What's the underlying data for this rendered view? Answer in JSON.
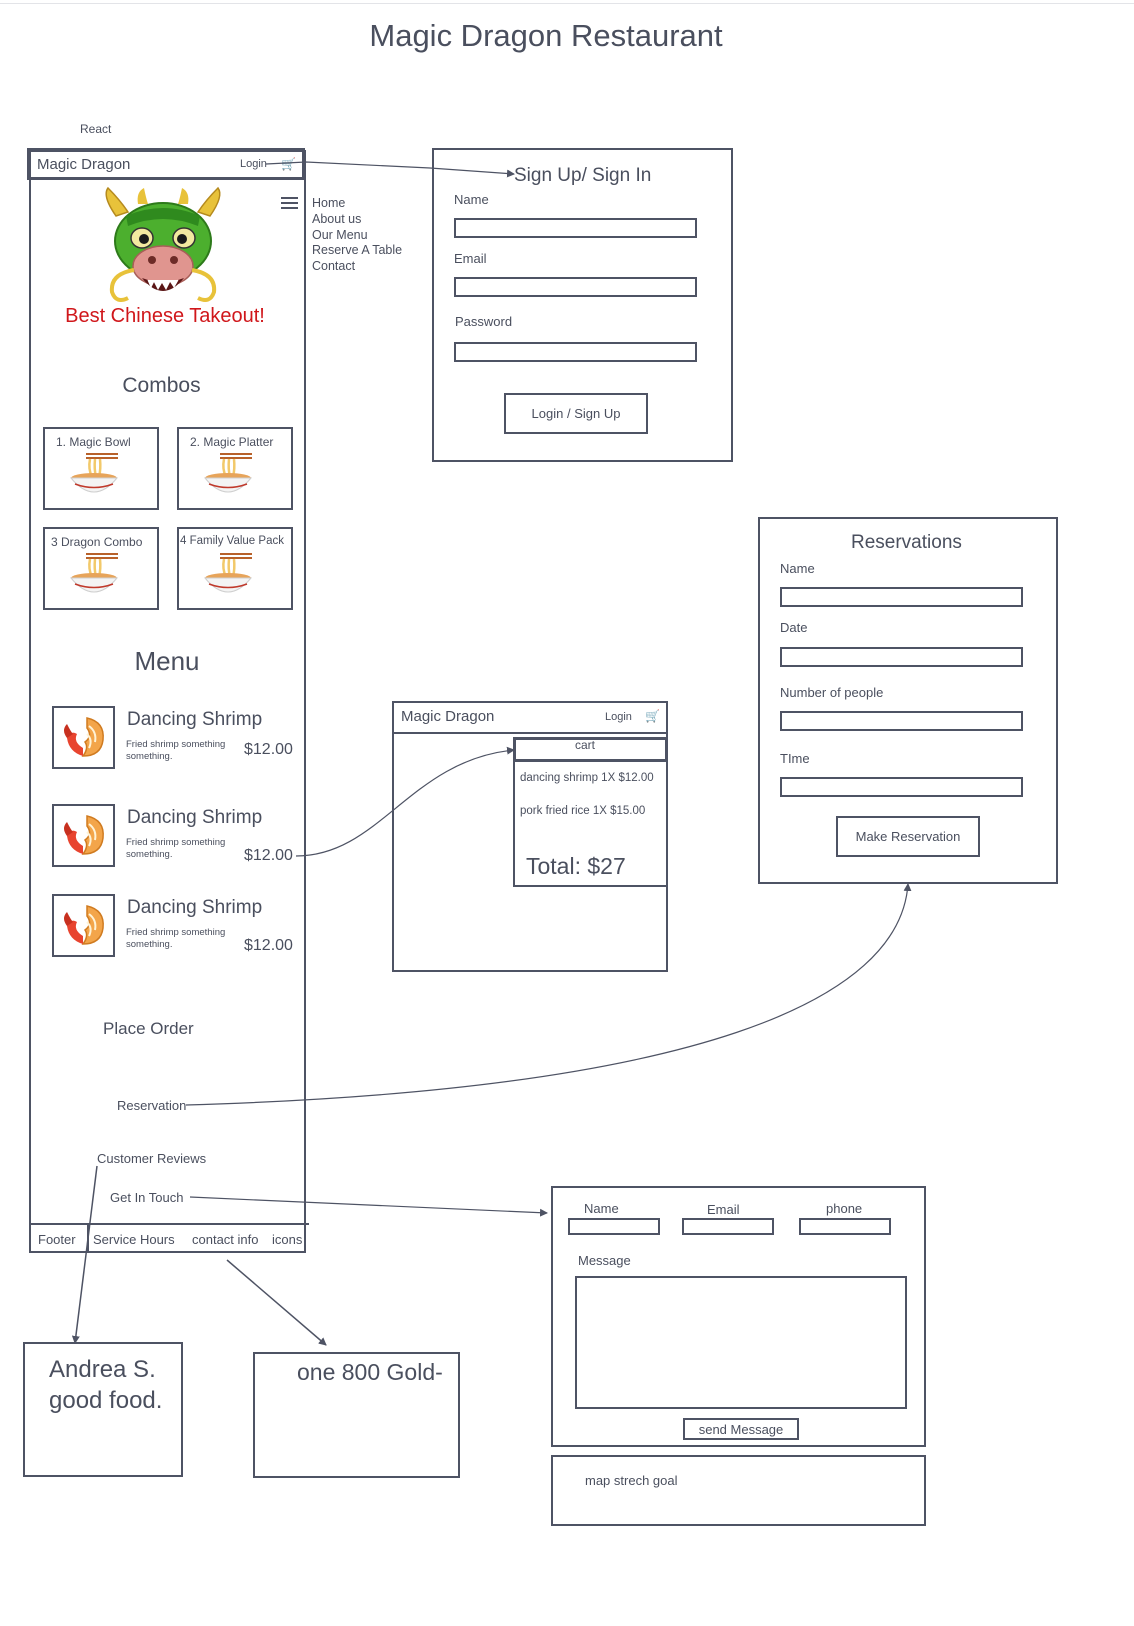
{
  "page_title": "Magic Dragon Restaurant",
  "react_label": "React",
  "phone": {
    "brand": "Magic Dragon",
    "login": "Login",
    "nav_items": [
      "Home",
      "About us",
      "Our Menu",
      "Reserve A Table",
      "Contact"
    ],
    "tagline": "Best Chinese Takeout!",
    "combos_heading": "Combos",
    "combos": [
      "1. Magic Bowl",
      "2. Magic Platter",
      "3 Dragon Combo",
      "4 Family Value Pack"
    ],
    "menu_heading": "Menu",
    "menu_items": [
      {
        "name": "Dancing Shrimp",
        "desc": "Fried shrimp something something.",
        "price": "$12.00"
      },
      {
        "name": "Dancing Shrimp",
        "desc": "Fried shrimp something something.",
        "price": "$12.00"
      },
      {
        "name": "Dancing Shrimp",
        "desc": "Fried shrimp something something.",
        "price": "$12.00"
      }
    ],
    "place_order": "Place Order",
    "reservation": "Reservation",
    "customer_reviews": "Customer Reviews",
    "get_in_touch": "Get In Touch",
    "footer": [
      "Footer",
      "Service Hours",
      "contact info",
      "icons"
    ]
  },
  "signin": {
    "title": "Sign Up/ Sign In",
    "name_label": "Name",
    "email_label": "Email",
    "password_label": "Password",
    "button": "Login / Sign Up"
  },
  "cart_screen": {
    "brand": "Magic Dragon",
    "login": "Login",
    "cart_title": "cart",
    "line1": "dancing shrimp 1X  $12.00",
    "line2": "pork fried rice 1X  $15.00",
    "total": "Total:  $27"
  },
  "reservations": {
    "title": "Reservations",
    "name_label": "Name",
    "date_label": "Date",
    "people_label": "Number of people",
    "time_label": "TIme",
    "button": "Make Reservation"
  },
  "contact": {
    "name_label": "Name",
    "email_label": "Email",
    "phone_label": "phone",
    "message_label": "Message",
    "button": "send Message",
    "map_note": "map  strech goal"
  },
  "review_box": {
    "line1": "Andrea S.",
    "line2": "good food."
  },
  "contact_info_box": {
    "text": "one 800 Gold-"
  },
  "colors": {
    "stroke": "#4e5364",
    "tagline": "#d0171b",
    "text": "#4a4f5e"
  }
}
